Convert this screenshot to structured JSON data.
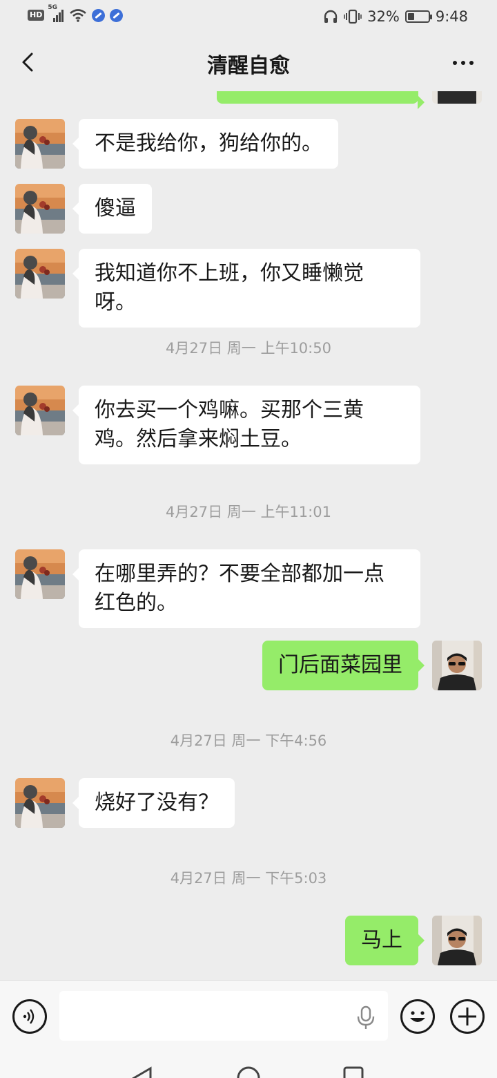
{
  "status_bar": {
    "hd_badge": "HD",
    "network": "5G",
    "battery_percent": "32%",
    "battery_level": 0.32,
    "time": "9:48"
  },
  "header": {
    "title": "清醒自愈"
  },
  "messages": [
    {
      "side": "left",
      "text": "不是我给你，狗给你的。"
    },
    {
      "side": "left",
      "text": "傻逼"
    },
    {
      "side": "left",
      "text": "我知道你不上班，你又睡懒觉呀。"
    },
    {
      "timestamp": "4月27日 周一 上午10:50"
    },
    {
      "side": "left",
      "text": "你去买一个鸡嘛。买那个三黄鸡。然后拿来焖土豆。"
    },
    {
      "timestamp": "4月27日 周一 上午11:01"
    },
    {
      "side": "left",
      "text": "在哪里弄的？不要全部都加一点红色的。"
    },
    {
      "side": "right",
      "text": "门后面菜园里"
    },
    {
      "timestamp": "4月27日 周一 下午4:56"
    },
    {
      "side": "left",
      "text": "烧好了没有？"
    },
    {
      "timestamp": "4月27日 周一 下午5:03"
    },
    {
      "side": "right",
      "text": "马上"
    }
  ],
  "input_bar": {
    "draft_text": ""
  },
  "icons": {
    "back": "chevron-left-icon",
    "more": "more-dots-icon",
    "voice": "voice-mode-icon",
    "mic": "microphone-icon",
    "emoji": "emoji-icon",
    "plus": "plus-icon"
  },
  "colors": {
    "background": "#ededed",
    "bubble_incoming": "#ffffff",
    "bubble_outgoing": "#95ec69",
    "timestamp_text": "#9d9d9d"
  }
}
